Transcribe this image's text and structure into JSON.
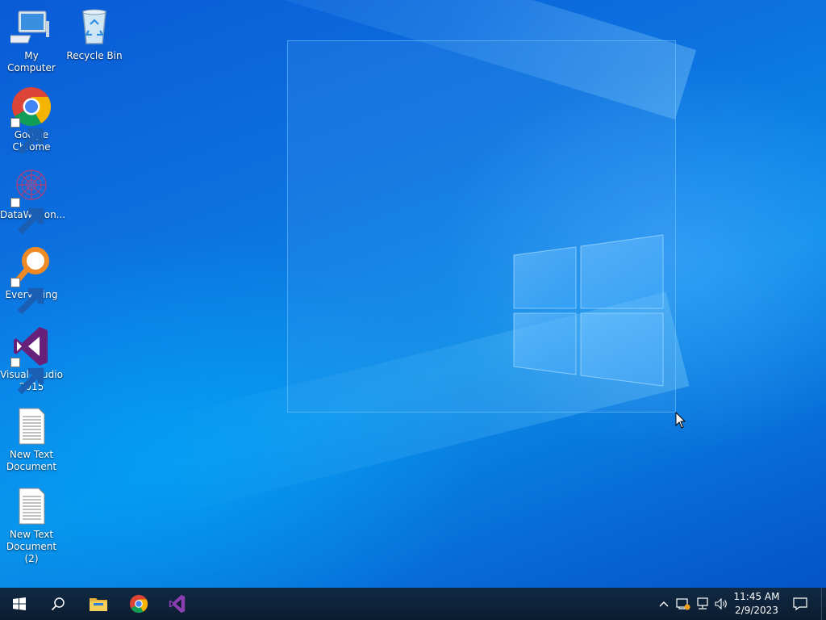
{
  "desktop": {
    "icons": [
      {
        "id": "my-computer",
        "label": "My Computer",
        "icon": "computer-icon",
        "shortcut": false
      },
      {
        "id": "recycle-bin",
        "label": "Recycle Bin",
        "icon": "recycle-bin-icon",
        "shortcut": false
      },
      {
        "id": "google-chrome",
        "label": "Google Chrome",
        "icon": "chrome-icon",
        "shortcut": true
      },
      {
        "id": "datawagon",
        "label": "DataWagon...",
        "icon": "datawagon-icon",
        "shortcut": true
      },
      {
        "id": "everything",
        "label": "Everything",
        "icon": "everything-search-icon",
        "shortcut": true
      },
      {
        "id": "visual-studio",
        "label": "Visual Studio 2015",
        "icon": "visual-studio-icon",
        "shortcut": true
      },
      {
        "id": "new-text-doc",
        "label": "New Text Document",
        "icon": "text-document-icon",
        "shortcut": false
      },
      {
        "id": "new-text-doc-2",
        "label": "New Text Document (2)",
        "icon": "text-document-icon",
        "shortcut": false
      }
    ]
  },
  "taskbar": {
    "start_icon": "windows-start-icon",
    "search_icon": "search-icon",
    "pinned": [
      {
        "id": "file-explorer",
        "icon": "file-explorer-icon"
      },
      {
        "id": "chrome",
        "icon": "chrome-icon"
      },
      {
        "id": "visual-studio",
        "icon": "visual-studio-icon"
      }
    ],
    "tray": {
      "icons": [
        "chevron-up-icon",
        "network-warning-icon",
        "network-icon",
        "volume-icon"
      ],
      "time": "11:45 AM",
      "date": "2/9/2023",
      "notification_icon": "action-center-icon"
    }
  },
  "colors": {
    "accent": "#0a73e0",
    "taskbar": "#0b1c30",
    "vs_purple": "#68217a",
    "everything_orange": "#f08a24"
  }
}
